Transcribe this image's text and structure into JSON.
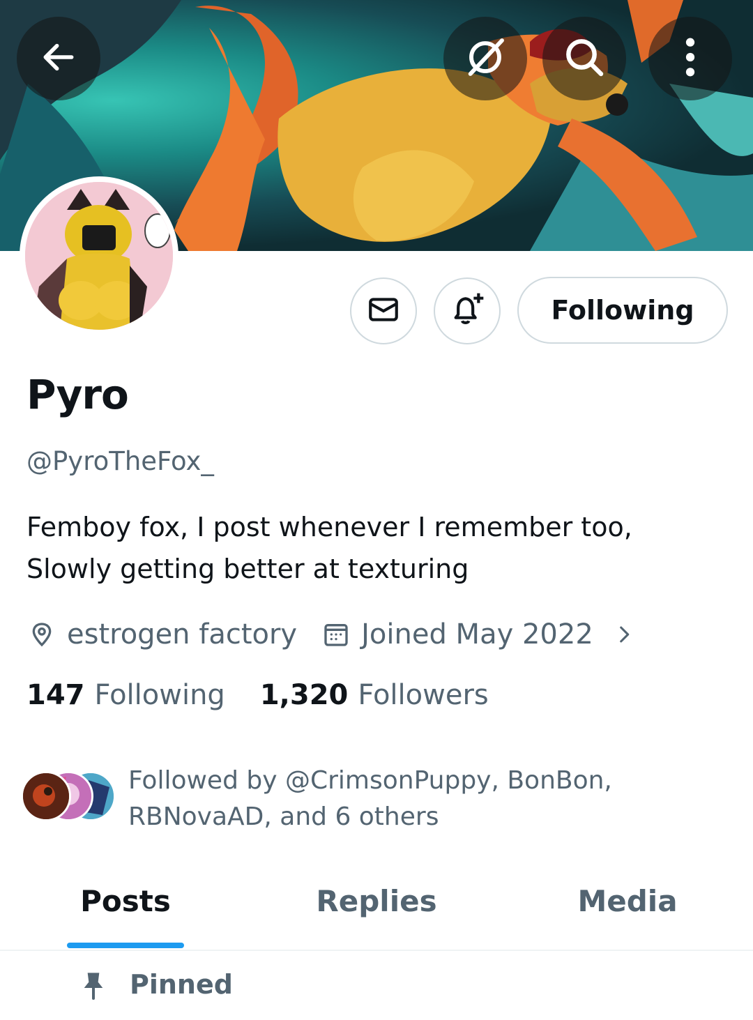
{
  "header": {
    "back_icon": "arrow-left-icon",
    "grok_icon": "grok-icon",
    "search_icon": "search-icon",
    "more_icon": "more-vertical-icon"
  },
  "profile": {
    "name": "Pyro",
    "handle": "@PyroTheFox_",
    "bio_line1": "Femboy fox, I post whenever I remember too,",
    "bio_line2": "Slowly getting better at texturing",
    "location": "estrogen factory",
    "joined": "Joined May 2022",
    "following_count": "147",
    "following_label": "Following",
    "followers_count": "1,320",
    "followers_label": "Followers",
    "followed_by_line1": "Followed by @CrimsonPuppy, BonBon,",
    "followed_by_line2": "RBNovaAD, and 6 others"
  },
  "actions": {
    "message_icon": "envelope-icon",
    "notify_icon": "bell-plus-icon",
    "follow_label": "Following"
  },
  "tabs": [
    {
      "label": "Posts",
      "active": true
    },
    {
      "label": "Replies",
      "active": false
    },
    {
      "label": "Media",
      "active": false
    }
  ],
  "pinned": {
    "label": "Pinned"
  },
  "colors": {
    "accent": "#1d9bf0",
    "text": "#0f1419",
    "secondary": "#536471",
    "border": "#cfd9de"
  }
}
